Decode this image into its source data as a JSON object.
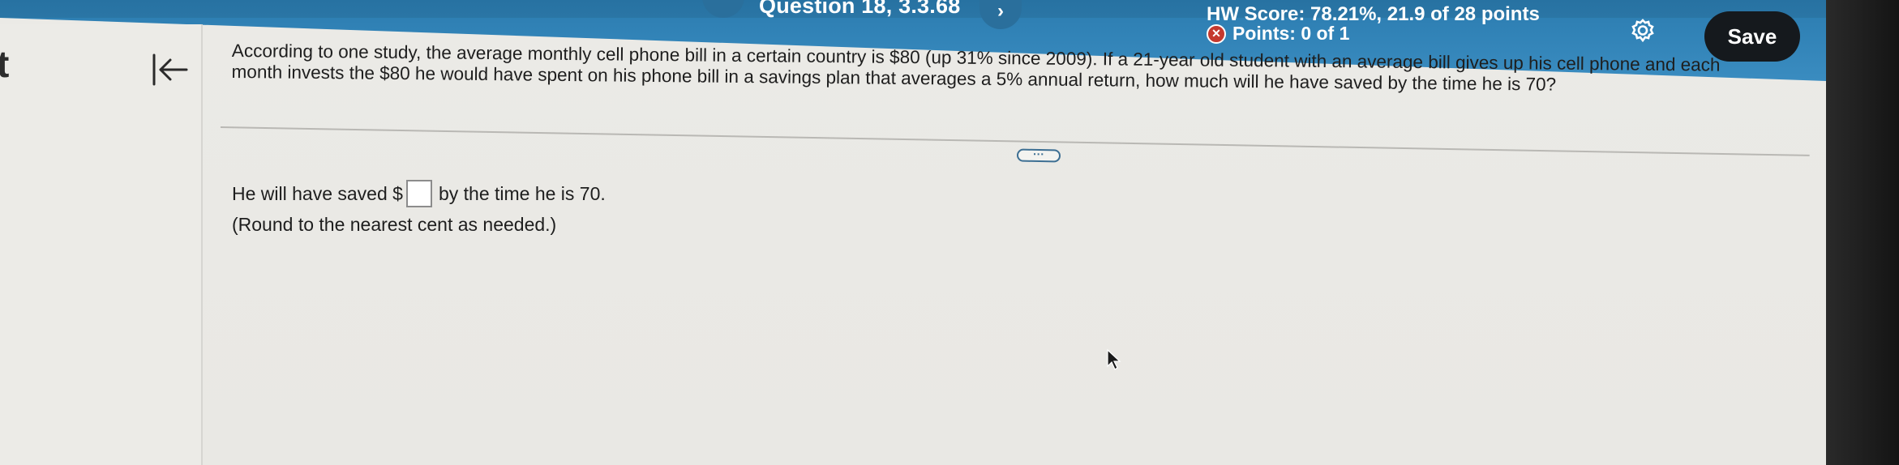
{
  "header": {
    "question_title": "Question 18, 3.3.68",
    "prev_symbol": "‹",
    "next_symbol": "›",
    "hw_score": "HW Score: 78.21%, 21.9 of 28 points",
    "points": "Points: 0 of 1",
    "points_status_icon": "x-circle-icon",
    "settings_icon": "gear-icon",
    "save_label": "Save"
  },
  "sidebar": {
    "partial_text": "t",
    "collapse_icon": "collapse-left-icon"
  },
  "question": {
    "text": "According to one study, the average monthly cell phone bill in a certain country is $80 (up 31% since 2009). If a 21-year old student with an average bill gives up his cell phone and each month invests the $80 he would have spent on his phone bill in a savings plan that averages a 5% annual return, how much will he have saved by the time he is 70?",
    "more_label": "···"
  },
  "answer": {
    "prefix": "He will have saved $",
    "input_value": "",
    "suffix": "by the time he is 70.",
    "note": "(Round to the nearest cent as needed.)"
  },
  "colors": {
    "header_blue": "#2b7cb0",
    "save_button": "#15191d",
    "incorrect_red": "#c5392e"
  }
}
